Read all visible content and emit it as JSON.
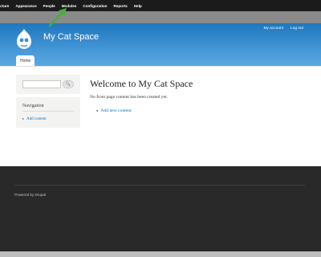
{
  "admin_toolbar": {
    "items": [
      "tructure",
      "Appearance",
      "People",
      "Modules",
      "Configuration",
      "Reports",
      "Help"
    ]
  },
  "header": {
    "site_name": "My Cat Space",
    "secondary_menu": [
      "My account",
      "Log out"
    ],
    "tabs": [
      "Home"
    ]
  },
  "sidebar": {
    "search_button_label": "🔍",
    "navigation_title": "Navigation",
    "navigation_items": [
      "Add content"
    ]
  },
  "main": {
    "title": "Welcome to My Cat Space",
    "message": "No front page content has been created yet.",
    "links": [
      "Add new content"
    ]
  },
  "footer": {
    "text": "Powered by Drupal"
  },
  "colors": {
    "header_blue": "#1e77bd",
    "link_blue": "#0071b3",
    "arrow_green": "#3fb13a",
    "footer_dark": "#292929"
  }
}
